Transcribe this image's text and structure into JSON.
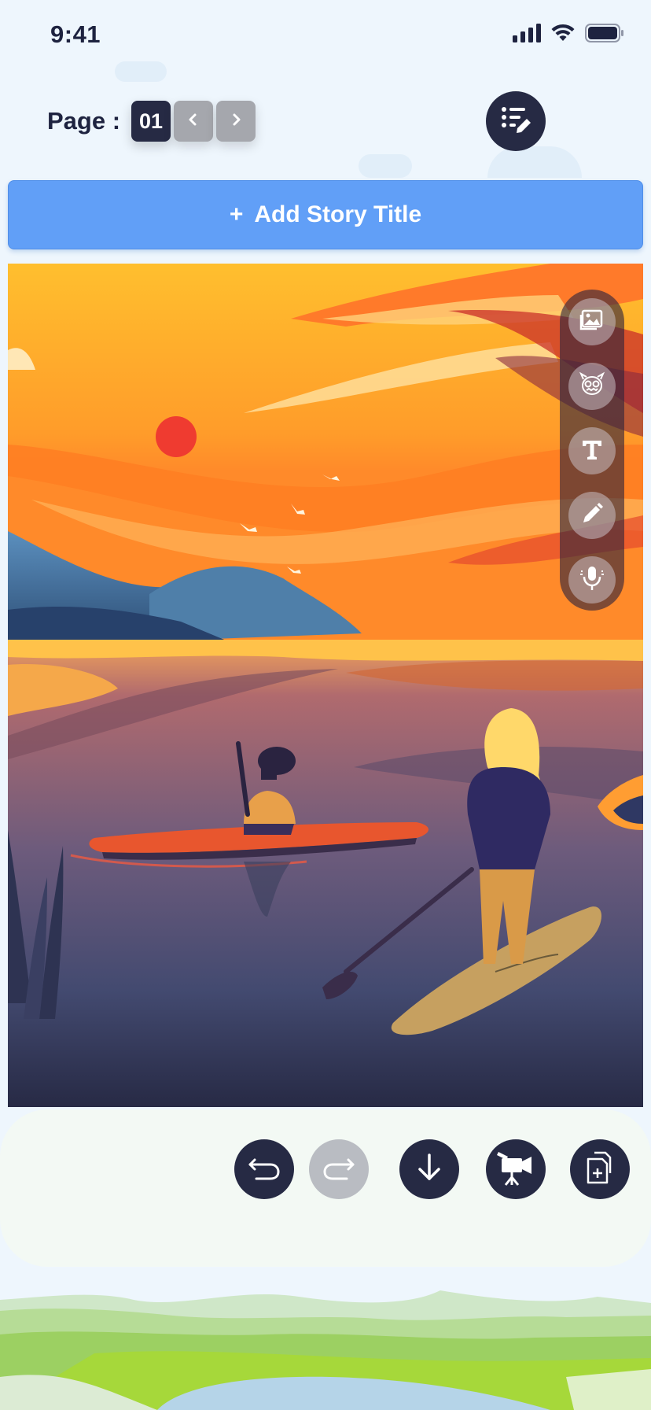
{
  "status_bar": {
    "time": "9:41",
    "icons": [
      "cellular-signal-icon",
      "wifi-icon",
      "battery-icon"
    ]
  },
  "pager": {
    "label": "Page :",
    "current_page": "01",
    "prev_icon": "chevron-left-icon",
    "next_icon": "chevron-right-icon"
  },
  "header": {
    "menu_icon": "list-edit-icon"
  },
  "title_bar": {
    "plus": "+",
    "label": "Add Story Title"
  },
  "tools": [
    {
      "name": "image-tool",
      "icon": "image-icon"
    },
    {
      "name": "character-tool",
      "icon": "monster-icon"
    },
    {
      "name": "text-tool",
      "icon": "text-icon"
    },
    {
      "name": "draw-tool",
      "icon": "pencil-icon"
    },
    {
      "name": "record-tool",
      "icon": "microphone-icon"
    }
  ],
  "actions": [
    {
      "name": "undo",
      "icon": "undo-icon",
      "enabled": true
    },
    {
      "name": "redo",
      "icon": "redo-icon",
      "enabled": false
    },
    {
      "name": "download",
      "icon": "arrow-down-icon",
      "enabled": true
    },
    {
      "name": "video",
      "icon": "video-camera-icon",
      "enabled": true
    },
    {
      "name": "add-page",
      "icon": "add-page-icon",
      "enabled": true
    }
  ],
  "colors": {
    "primary_dark": "#262a44",
    "accent_blue": "#619ff7",
    "disabled_gray": "#b9bcc2",
    "background": "#eef6fd"
  }
}
